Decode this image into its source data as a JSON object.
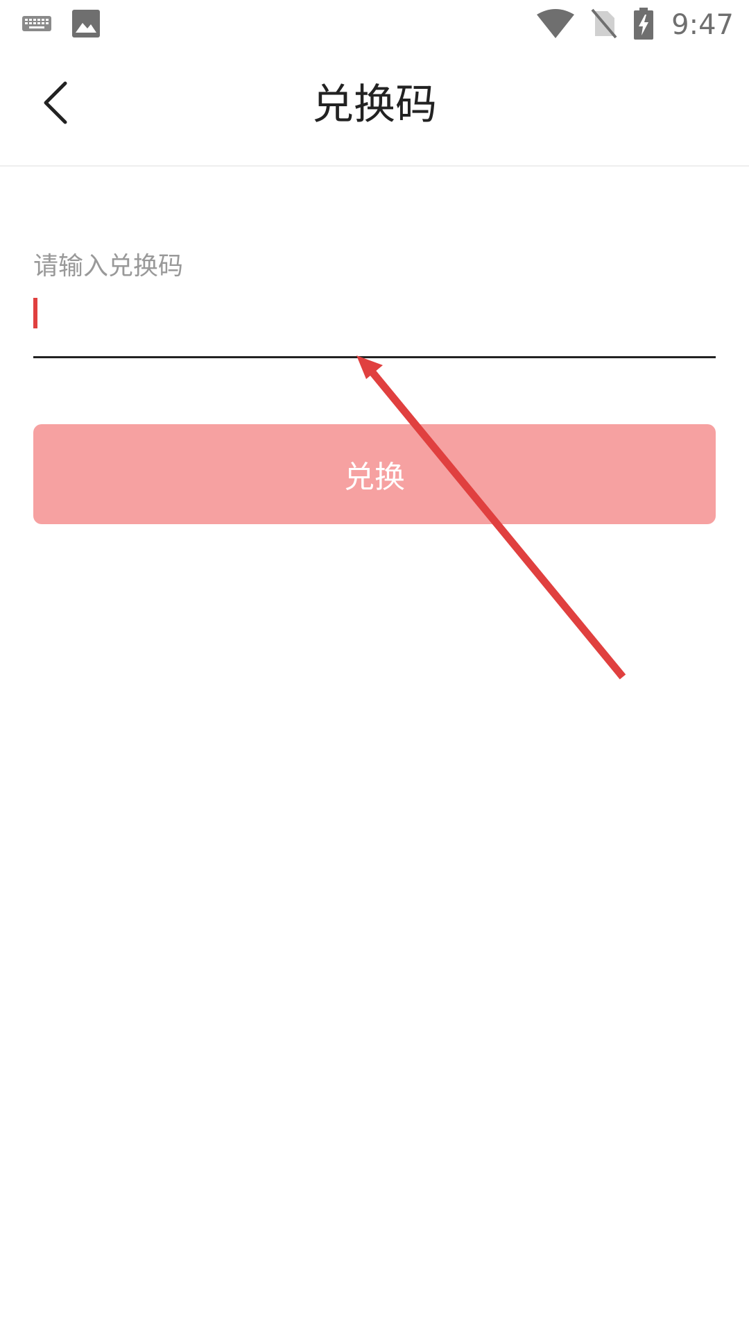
{
  "status_bar": {
    "time": "9:47",
    "icons": [
      "keyboard-icon",
      "image-icon",
      "wifi-icon",
      "no-sim-icon",
      "battery-charging-icon"
    ]
  },
  "app_bar": {
    "title": "兑换码",
    "back_icon": "chevron-left-icon"
  },
  "form": {
    "label": "请输入兑换码",
    "input_value": "",
    "button_label": "兑换"
  },
  "colors": {
    "accent": "#e0403f",
    "button_bg": "#f6a1a1",
    "arrow": "#e0403f"
  }
}
